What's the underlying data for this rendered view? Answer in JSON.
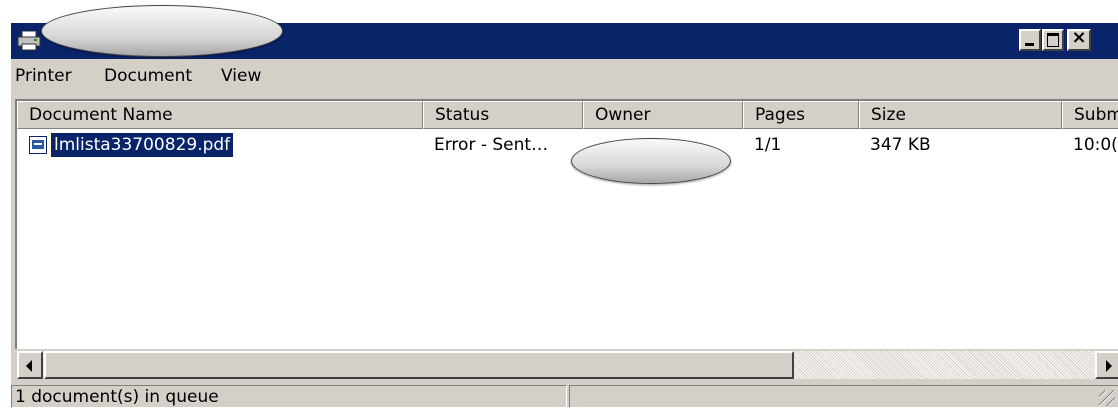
{
  "window": {
    "icon": "printer-icon"
  },
  "menu": [
    "Printer",
    "Document",
    "View"
  ],
  "columns": [
    "Document Name",
    "Status",
    "Owner",
    "Pages",
    "Size",
    "Subm"
  ],
  "rows": [
    {
      "icon": "document-icon",
      "name": "lmlista33700829.pdf",
      "status": "Error - Sent…",
      "owner": "",
      "pages": "1/1",
      "size": "347 KB",
      "submitted": "10:0("
    }
  ],
  "status_bar": {
    "queue_text": "1 document(s) in queue",
    "right_text": ""
  },
  "colors": {
    "titlebar": "#0a246a",
    "selection": "#0a246a",
    "face": "#d4d0c8"
  }
}
